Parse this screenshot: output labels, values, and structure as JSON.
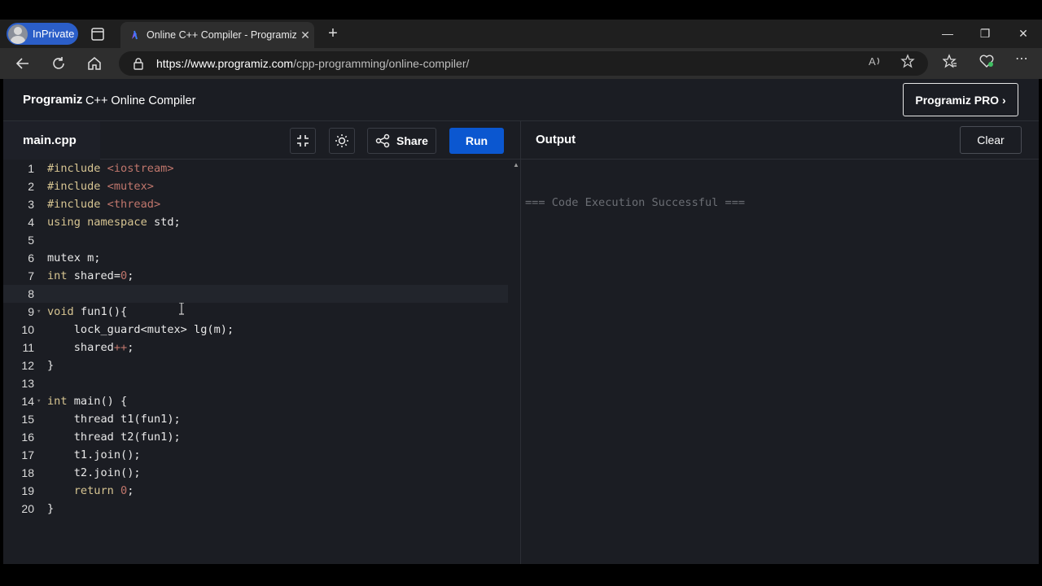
{
  "browser": {
    "inprivate_label": "InPrivate",
    "tab_title": "Online C++ Compiler - Programiz",
    "url_host": "https://www.programiz.com",
    "url_path": "/cpp-programming/online-compiler/"
  },
  "header": {
    "logo": "Programiz",
    "subtitle": "C++ Online Compiler",
    "pro_button": "Programiz PRO ›"
  },
  "editor": {
    "file_tab": "main.cpp",
    "share_label": "Share",
    "run_label": "Run",
    "lines": [
      {
        "n": "1",
        "code": "#include <iostream>"
      },
      {
        "n": "2",
        "code": "#include <mutex>"
      },
      {
        "n": "3",
        "code": "#include <thread>"
      },
      {
        "n": "4",
        "code": "using namespace std;"
      },
      {
        "n": "5",
        "code": ""
      },
      {
        "n": "6",
        "code": "mutex m;"
      },
      {
        "n": "7",
        "code": "int shared=0;"
      },
      {
        "n": "8",
        "code": ""
      },
      {
        "n": "9",
        "code": "void fun1(){"
      },
      {
        "n": "10",
        "code": "    lock_guard<mutex> lg(m);"
      },
      {
        "n": "11",
        "code": "    shared++;"
      },
      {
        "n": "12",
        "code": "}"
      },
      {
        "n": "13",
        "code": ""
      },
      {
        "n": "14",
        "code": "int main() {"
      },
      {
        "n": "15",
        "code": "    thread t1(fun1);"
      },
      {
        "n": "16",
        "code": "    thread t2(fun1);"
      },
      {
        "n": "17",
        "code": "    t1.join();"
      },
      {
        "n": "18",
        "code": "    t2.join();"
      },
      {
        "n": "19",
        "code": "    return 0;"
      },
      {
        "n": "20",
        "code": "}"
      }
    ]
  },
  "output": {
    "title": "Output",
    "clear_label": "Clear",
    "text": "=== Code Execution Successful ==="
  }
}
